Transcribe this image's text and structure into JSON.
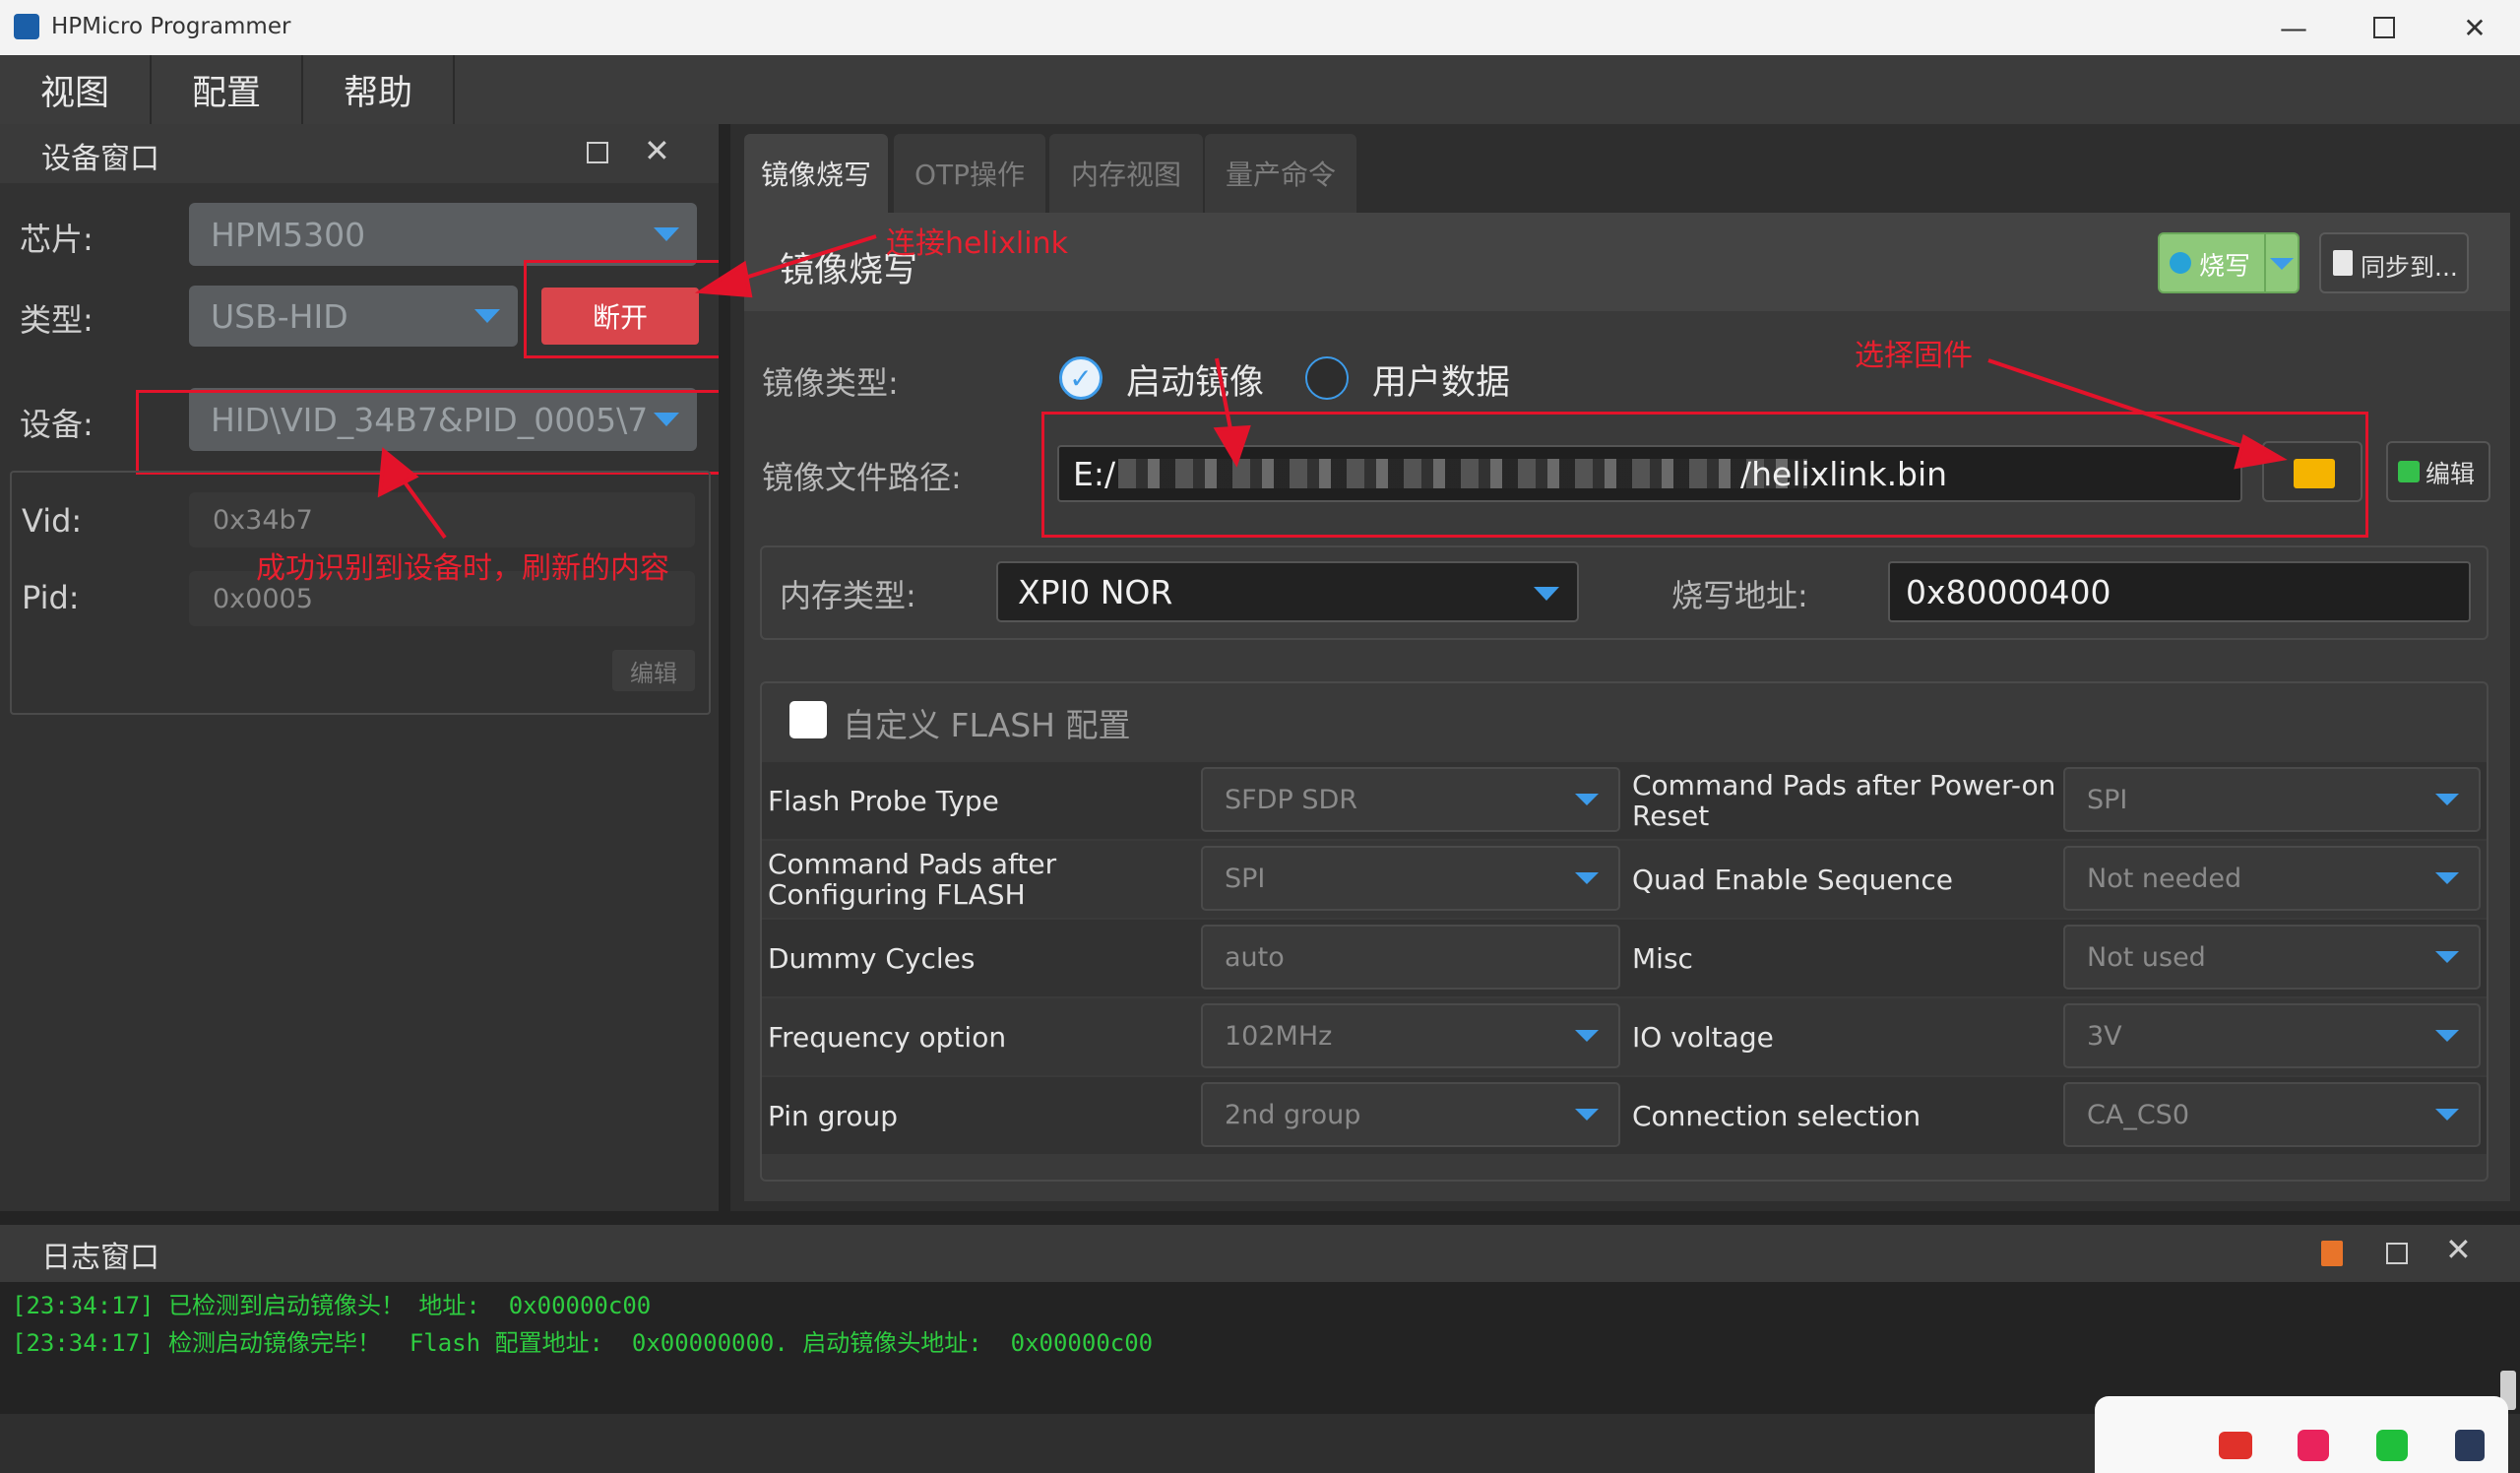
{
  "window": {
    "title": "HPMicro Programmer",
    "minimize_icon": "minimize-icon",
    "maximize_icon": "maximize-icon",
    "close_icon": "close-icon"
  },
  "menu": {
    "items": [
      "视图",
      "配置",
      "帮助"
    ]
  },
  "device_panel": {
    "title": "设备窗口",
    "chip_label": "芯片:",
    "chip_value": "HPM5300",
    "type_label": "类型:",
    "type_value": "USB-HID",
    "disconnect_button": "断开",
    "device_label": "设备:",
    "device_value": "HID\\VID_34B7&PID_0005\\7",
    "vid_label": "Vid:",
    "vid_value": "0x34b7",
    "pid_label": "Pid:",
    "pid_value": "0x0005",
    "edit_button": "编辑"
  },
  "annotations": {
    "connect": "连接helixlink",
    "refresh": "成功识别到设备时，刷新的内容",
    "select_firmware": "选择固件"
  },
  "tabs": [
    "镜像烧写",
    "OTP操作",
    "内存视图",
    "量产命令"
  ],
  "flash_panel": {
    "title": "镜像烧写",
    "burn_button": "烧写",
    "sync_button": "同步到...",
    "image_type_label": "镜像类型:",
    "option_boot": "启动镜像",
    "option_user": "用户数据",
    "image_path_label": "镜像文件路径:",
    "image_path_prefix": "E:/",
    "image_path_suffix": "/helixlink.bin",
    "edit_button": "编辑",
    "memory_type_label": "内存类型:",
    "memory_type_value": "XPI0 NOR",
    "address_label": "烧写地址:",
    "address_value": "0x80000400",
    "custom_flash_label": "自定义 FLASH 配置"
  },
  "flash_config": [
    {
      "left_label": "Flash Probe Type",
      "left_value": "SFDP SDR",
      "right_label": "Command Pads after Power-on Reset",
      "right_value": "SPI"
    },
    {
      "left_label": "Command Pads after Configuring FLASH",
      "left_value": "SPI",
      "right_label": "Quad Enable Sequence",
      "right_value": "Not needed"
    },
    {
      "left_label": "Dummy Cycles",
      "left_value": "auto",
      "right_label": "Misc",
      "right_value": "Not used"
    },
    {
      "left_label": "Frequency option",
      "left_value": "102MHz",
      "right_label": "IO voltage",
      "right_value": "3V"
    },
    {
      "left_label": "Pin group",
      "left_value": "2nd group",
      "right_label": "Connection selection",
      "right_value": "CA_CS0"
    }
  ],
  "log_panel": {
    "title": "日志窗口",
    "lines": [
      "[23:34:17] 已检测到启动镜像头！ 地址:  0x00000c00",
      "[23:34:17] 检测启动镜像完毕！  Flash 配置地址:  0x00000000. 启动镜像头地址:  0x00000c00"
    ]
  },
  "colors": {
    "accent_blue": "#3d9be9",
    "annotation_red": "#e3132a",
    "disconnect_red": "#d9454b",
    "log_green": "#2ecc40",
    "burn_green": "#8ec97a"
  }
}
